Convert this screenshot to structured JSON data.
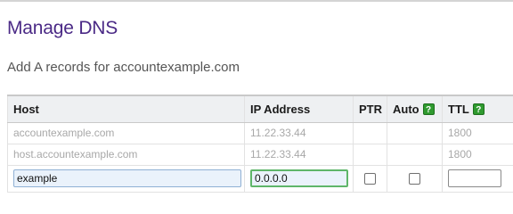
{
  "page": {
    "title": "Manage DNS",
    "subtitle": "Add A records for accountexample.com"
  },
  "table": {
    "headers": {
      "host": "Host",
      "ip": "IP Address",
      "ptr": "PTR",
      "auto": "Auto",
      "ttl": "TTL"
    },
    "help_icon_glyph": "?",
    "rows": [
      {
        "host": "accountexample.com",
        "ip": "11.22.33.44",
        "ttl": "1800"
      },
      {
        "host": "host.accountexample.com",
        "ip": "11.22.33.44",
        "ttl": "1800"
      }
    ],
    "new_row": {
      "host_value": "example",
      "ip_value": "0.0.0.0",
      "ptr_checked": false,
      "auto_checked": false,
      "ttl_value": ""
    }
  },
  "colors": {
    "title": "#4b2a86",
    "help_icon": "#2f9a2f",
    "ip_input_border": "#5fb66a"
  },
  "icons": {
    "help": "help-icon"
  }
}
